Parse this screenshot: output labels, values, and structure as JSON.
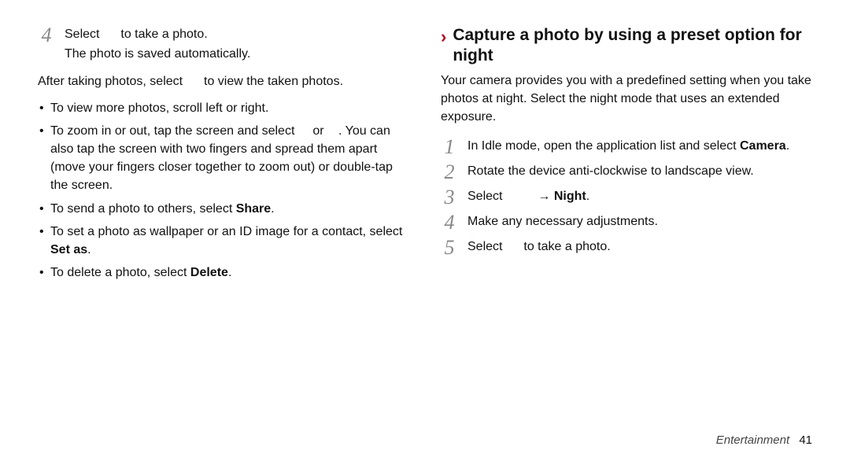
{
  "left": {
    "step4": {
      "num": "4",
      "line1_before": "Select",
      "line1_after": "to take a photo.",
      "line2": "The photo is saved automatically."
    },
    "afterPara_before": "After taking photos, select",
    "afterPara_after": "to view the taken photos.",
    "bullets": {
      "b1": "To view more photos, scroll left or right.",
      "b2_before": "To zoom in or out, tap the screen and select",
      "b2_mid": "or",
      "b2_after": "You can also tap the screen with two fingers and spread them apart (move your fingers closer together to zoom out) or double-tap the screen.",
      "b3_before": "To send a photo to others, select ",
      "b3_bold": "Share",
      "b3_after": ".",
      "b4_before": "To set a photo as wallpaper or an ID image for a contact, select ",
      "b4_bold": "Set as",
      "b4_after": ".",
      "b5_before": "To delete a photo, select ",
      "b5_bold": "Delete",
      "b5_after": "."
    }
  },
  "right": {
    "heading": "Capture a photo by using a preset option for night",
    "intro": "Your camera provides you with a predefined setting when you take photos at night. Select the night mode that uses an extended exposure.",
    "steps": {
      "s1": {
        "num": "1",
        "before": "In Idle mode, open the application list and select ",
        "bold": "Camera",
        "after": "."
      },
      "s2": {
        "num": "2",
        "text": "Rotate the device anti-clockwise to landscape view."
      },
      "s3": {
        "num": "3",
        "before1": "Select",
        "arrow": "→",
        "bold": "Night",
        "after": "."
      },
      "s4": {
        "num": "4",
        "text": "Make any necessary adjustments."
      },
      "s5": {
        "num": "5",
        "before": "Select",
        "after": "to take a photo."
      }
    }
  },
  "footer": {
    "section": "Entertainment",
    "page": "41"
  }
}
